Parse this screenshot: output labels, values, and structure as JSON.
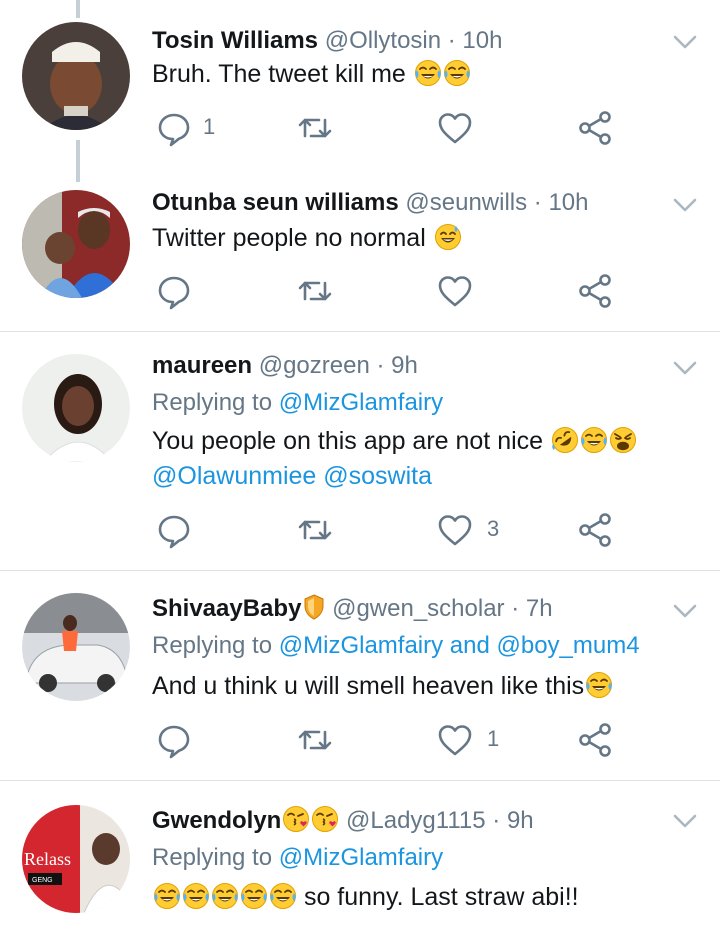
{
  "tweets": [
    {
      "name": "Tosin Williams",
      "handle": "@Ollytosin",
      "time": "10h",
      "text": "Bruh. The tweet kill me",
      "emojis": [
        "face-with-tears-of-joy",
        "face-with-tears-of-joy"
      ],
      "reply_count": "1",
      "like_count": ""
    },
    {
      "name": "Otunba seun williams",
      "handle": "@seunwills",
      "time": "10h",
      "text": "Twitter people no normal",
      "emojis": [
        "grinning-sweat-face"
      ],
      "reply_count": "",
      "like_count": ""
    },
    {
      "name": "maureen",
      "handle": "@gozreen",
      "time": "9h",
      "replying_prefix": "Replying to",
      "replying_to": "@MizGlamfairy",
      "text": "You people on this app are not nice",
      "emojis": [
        "rolling-on-floor-laughing",
        "face-with-tears-of-joy",
        "weary-face"
      ],
      "mentions": "@Olawunmiee @soswita",
      "reply_count": "",
      "like_count": "3"
    },
    {
      "name": "ShivaayBaby",
      "name_badge": "shield-emoji",
      "handle": "@gwen_scholar",
      "time": "7h",
      "replying_prefix": "Replying to",
      "replying_to": "@MizGlamfairy and @boy_mum4",
      "text": "And u think u will smell heaven like this",
      "emojis": [
        "face-with-tears-of-joy"
      ],
      "reply_count": "",
      "like_count": "1"
    },
    {
      "name": "Gwendolyn",
      "name_emojis": [
        "face-blowing-kiss",
        "face-blowing-kiss"
      ],
      "handle": "@Ladyg1115",
      "time": "9h",
      "replying_prefix": "Replying to",
      "replying_to": "@MizGlamfairy",
      "lead_emojis": [
        "face-with-tears-of-joy",
        "face-with-tears-of-joy",
        "face-with-tears-of-joy",
        "face-with-tears-of-joy",
        "face-with-tears-of-joy"
      ],
      "text": "so funny. Last straw abi!!",
      "avatar_text": "Relass",
      "avatar_subtext": "GENG"
    }
  ],
  "separator": " · ",
  "colors": {
    "accent": "#1b95e0",
    "secondary_text": "#657786",
    "icon": "#657786",
    "divider": "#dfe3e6",
    "thread_line": "#c4cfd6"
  },
  "icons": {
    "reply": "reply-bubble-icon",
    "retweet": "retweet-icon",
    "like": "heart-icon",
    "share": "share-icon",
    "menu": "chevron-down-icon"
  }
}
